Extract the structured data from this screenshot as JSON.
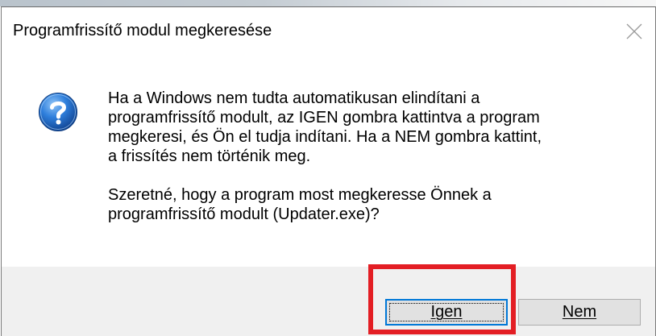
{
  "dialog": {
    "title": "Programfrissítő modul megkeresése",
    "message_paragraph_1": "Ha a Windows nem tudta automatikusan elindítani a\nprogramfrissítő modult, az IGEN gombra kattintva a program\nmegkeresi, és Ön el tudja indítani. Ha a NEM gombra kattint,\na frissítés nem történik meg.",
    "message_paragraph_2": "Szeretné, hogy a program most megkeresse Önnek a\nprogramfrissítő modult (Updater.exe)?",
    "icon": "question-icon",
    "buttons": {
      "yes_label": "Igen",
      "no_label": "Nem"
    }
  },
  "annotation": {
    "highlight_color": "#e31e24",
    "highlighted": "yes-button"
  },
  "colors": {
    "icon_blue": "#1f6fd1",
    "focus_border": "#0078d7",
    "footer_bg": "#f0f0f0"
  }
}
